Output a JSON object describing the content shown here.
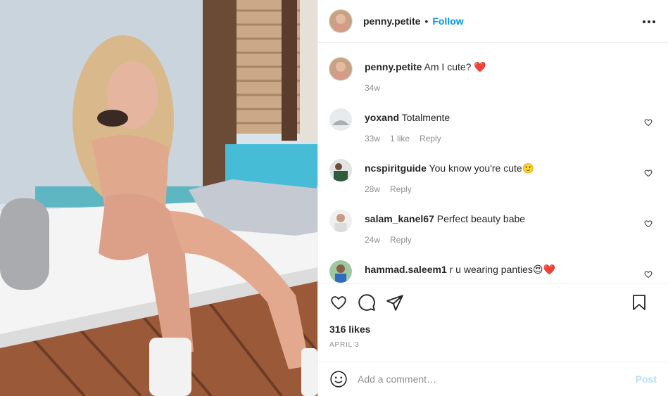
{
  "post": {
    "author": "penny.petite",
    "follow_label": "Follow",
    "separator": "•",
    "caption": "Am I cute? ❤️",
    "caption_age": "34w"
  },
  "comments": [
    {
      "username": "yoxand",
      "text": "Totalmente",
      "age": "33w",
      "likes": "1 like",
      "reply": "Reply"
    },
    {
      "username": "ncspiritguide",
      "text": "You know you're cute🙂",
      "age": "28w",
      "reply": "Reply"
    },
    {
      "username": "salam_kanel67",
      "text": "Perfect beauty babe",
      "age": "24w",
      "reply": "Reply"
    },
    {
      "username": "hammad.saleem1",
      "text": "r u wearing panties😍❤️"
    }
  ],
  "stats": {
    "likes": "316 likes",
    "date": "APRIL 3"
  },
  "add_comment": {
    "placeholder": "Add a comment…",
    "post_label": "Post"
  },
  "icons": {
    "more": "more-horizontal-icon",
    "like": "heart-icon",
    "comment": "comment-bubble-icon",
    "share": "paper-plane-icon",
    "save": "bookmark-icon",
    "emoji": "smiley-icon"
  },
  "colors": {
    "accent": "#0095f6",
    "post_disabled": "#b2dffc",
    "muted": "#8e8e8e",
    "text": "#262626"
  }
}
